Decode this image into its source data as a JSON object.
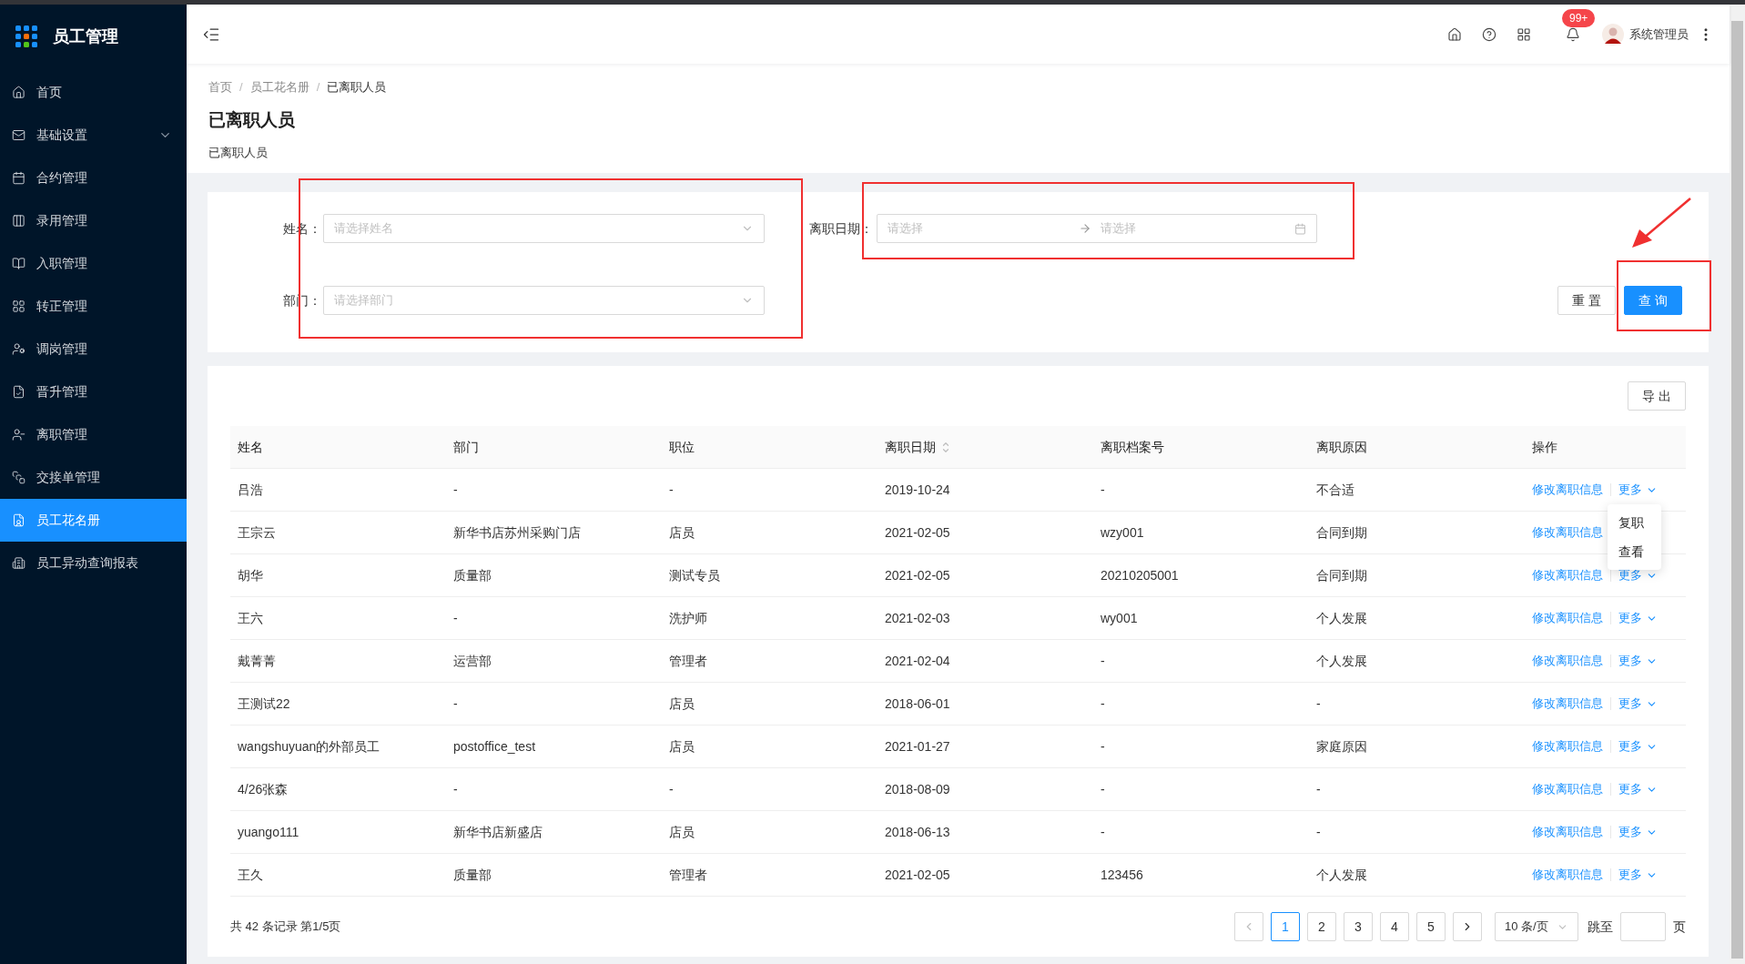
{
  "app": {
    "title": "员工管理"
  },
  "sidebar": {
    "items": [
      {
        "label": "首页",
        "kind": "link",
        "selected": false
      },
      {
        "label": "基础设置",
        "kind": "group",
        "selected": false
      },
      {
        "label": "合约管理",
        "kind": "link",
        "selected": false
      },
      {
        "label": "录用管理",
        "kind": "link",
        "selected": false
      },
      {
        "label": "入职管理",
        "kind": "link",
        "selected": false
      },
      {
        "label": "转正管理",
        "kind": "link",
        "selected": false
      },
      {
        "label": "调岗管理",
        "kind": "link",
        "selected": false
      },
      {
        "label": "晋升管理",
        "kind": "link",
        "selected": false
      },
      {
        "label": "离职管理",
        "kind": "link",
        "selected": false
      },
      {
        "label": "交接单管理",
        "kind": "link",
        "selected": false
      },
      {
        "label": "员工花名册",
        "kind": "link",
        "selected": true
      },
      {
        "label": "员工异动查询报表",
        "kind": "link",
        "selected": false
      }
    ]
  },
  "header": {
    "notification_badge": "99+",
    "user": "系统管理员"
  },
  "breadcrumb": [
    "首页",
    "员工花名册",
    "已离职人员"
  ],
  "breadcrumb_separator": "/",
  "page": {
    "title": "已离职人员",
    "subtitle": "已离职人员"
  },
  "filters": {
    "fields": [
      {
        "label": "姓名：",
        "placeholder": "请选择姓名"
      },
      {
        "label": "部门：",
        "placeholder": "请选择部门"
      }
    ],
    "date_range": {
      "label": "离职日期：",
      "start_placeholder": "请选择",
      "end_placeholder": "请选择"
    },
    "buttons": [
      {
        "label": "重 置",
        "kind": "default"
      },
      {
        "label": "查 询",
        "kind": "primary"
      }
    ]
  },
  "table": {
    "export": "导 出",
    "columns": [
      {
        "label": "姓名",
        "sortable": false
      },
      {
        "label": "部门",
        "sortable": false
      },
      {
        "label": "职位",
        "sortable": false
      },
      {
        "label": "离职日期",
        "sortable": true
      },
      {
        "label": "离职档案号",
        "sortable": false
      },
      {
        "label": "离职原因",
        "sortable": false
      },
      {
        "label": "操作",
        "sortable": false
      }
    ],
    "rows": [
      {
        "cells": [
          "吕浩",
          "-",
          "-",
          "2019-10-24",
          "-",
          "不合适"
        ],
        "edit": "修改离职信息",
        "more": "更多",
        "menu": [
          "复职",
          "查看"
        ]
      },
      {
        "cells": [
          "王宗云",
          "新华书店苏州采购门店",
          "店员",
          "2021-02-05",
          "wzy001",
          "合同到期"
        ],
        "edit": "修改离职信息"
      },
      {
        "cells": [
          "胡华",
          "质量部",
          "测试专员",
          "2021-02-05",
          "20210205001",
          "合同到期"
        ],
        "edit": "修改离职信息",
        "more": "更多"
      },
      {
        "cells": [
          "王六",
          "-",
          "洗护师",
          "2021-02-03",
          "wy001",
          "个人发展"
        ],
        "edit": "修改离职信息",
        "more": "更多"
      },
      {
        "cells": [
          "戴菁菁",
          "运营部",
          "管理者",
          "2021-02-04",
          "-",
          "个人发展"
        ],
        "edit": "修改离职信息",
        "more": "更多"
      },
      {
        "cells": [
          "王测试22",
          "-",
          "店员",
          "2018-06-01",
          "-",
          "-"
        ],
        "edit": "修改离职信息",
        "more": "更多"
      },
      {
        "cells": [
          "wangshuyuan的外部员工",
          "postoffice_test",
          "店员",
          "2021-01-27",
          "-",
          "家庭原因"
        ],
        "edit": "修改离职信息",
        "more": "更多"
      },
      {
        "cells": [
          "4/26张森",
          "-",
          "-",
          "2018-08-09",
          "-",
          "-"
        ],
        "edit": "修改离职信息",
        "more": "更多"
      },
      {
        "cells": [
          "yuango111",
          "新华书店新盛店",
          "店员",
          "2018-06-13",
          "-",
          "-"
        ],
        "edit": "修改离职信息",
        "more": "更多"
      },
      {
        "cells": [
          "王久",
          "质量部",
          "管理者",
          "2021-02-05",
          "123456",
          "个人发展"
        ],
        "edit": "修改离职信息",
        "more": "更多"
      }
    ]
  },
  "pagination": {
    "summary": "共 42 条记录 第1/5页",
    "pages": [
      {
        "label": "1",
        "selected": true
      },
      {
        "label": "2",
        "selected": false
      },
      {
        "label": "3",
        "selected": false
      },
      {
        "label": "4",
        "selected": false
      },
      {
        "label": "5",
        "selected": false
      }
    ],
    "page_size": "10 条/页",
    "jump_label": "跳至",
    "page_suffix": "页"
  }
}
